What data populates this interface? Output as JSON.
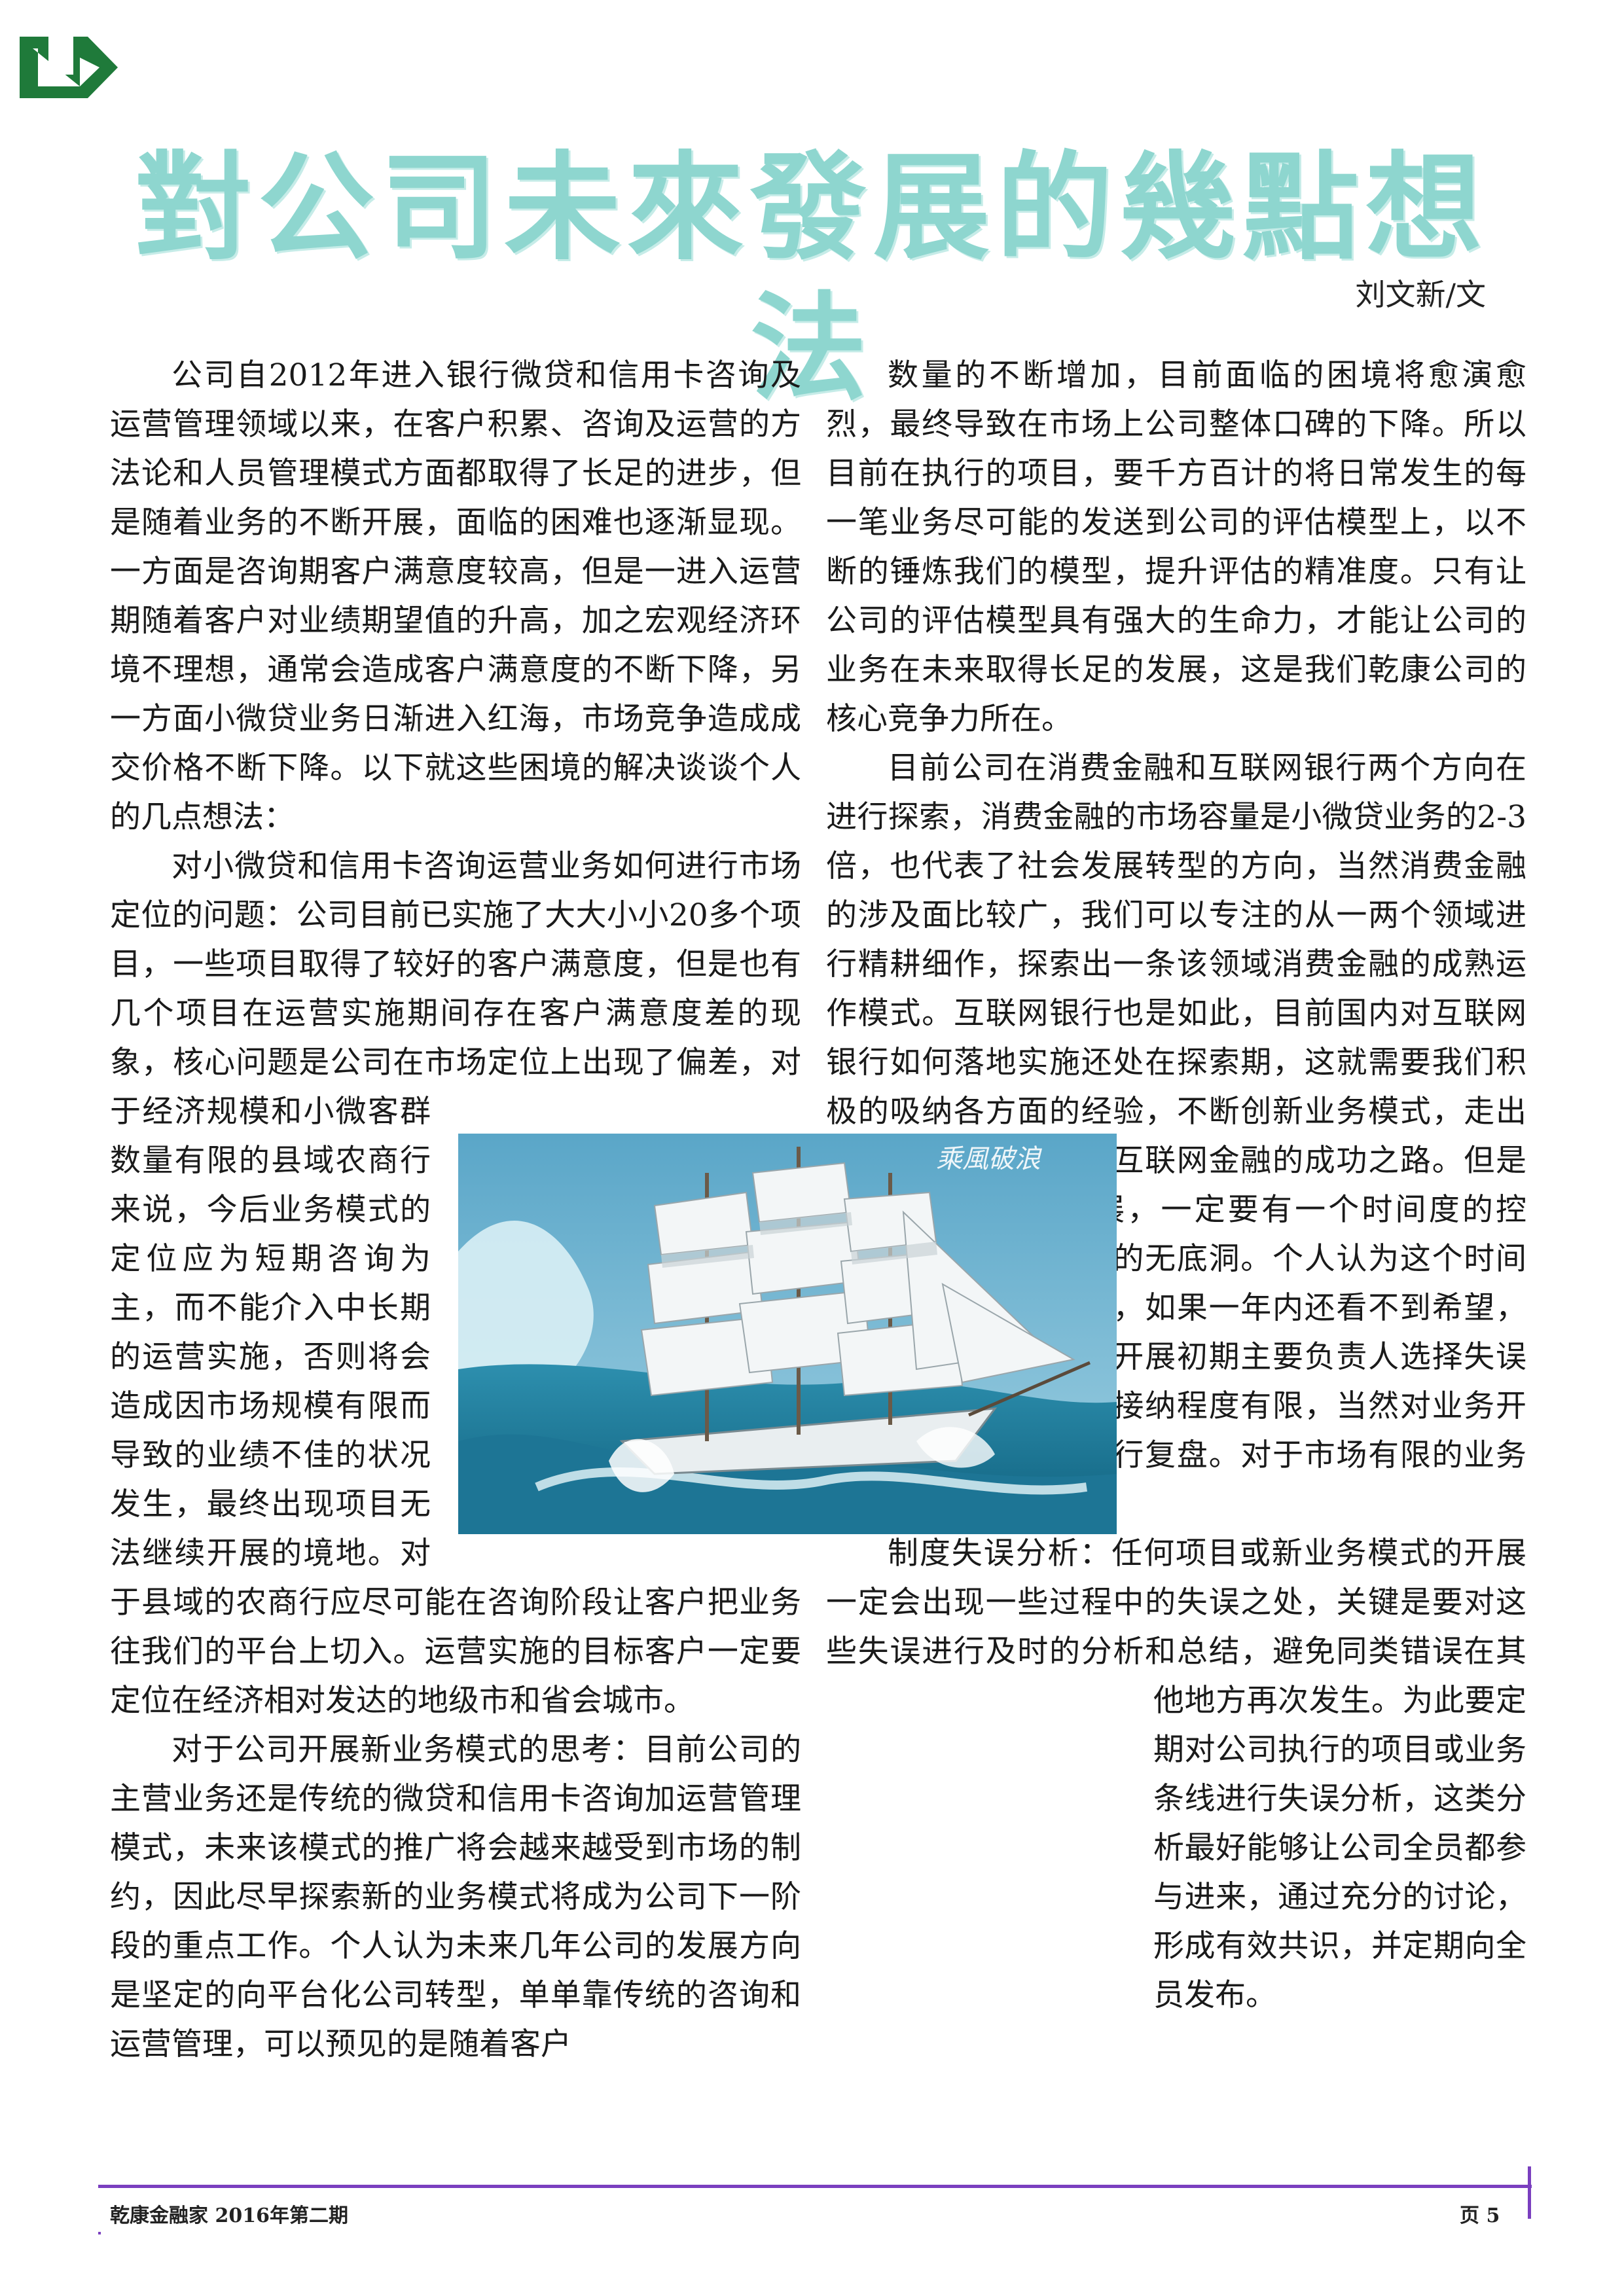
{
  "title": "對公司未來發展的幾點想法",
  "author": "刘文新/文",
  "image": {
    "caption": "乘風破浪"
  },
  "left_column": {
    "p1": "公司自2012年进入银行微贷和信用卡咨询及运营管理领域以来，在客户积累、咨询及运营的方法论和人员管理模式方面都取得了长足的进步，但是随着业务的不断开展，面临的困难也逐渐显现。一方面是咨询期客户满意度较高，但是一进入运营期随着客户对业绩期望值的升高，加之宏观经济环境不理想，通常会造成客户满意度的不断下降，另一方面小微贷业务日渐进入红海，市场竞争造成成交价格不断下降。以下就这些困境的解决谈谈个人的几点想法：",
    "p2": "对小微贷和信用卡咨询运营业务如何进行市场定位的问题：公司目前已实施了大大小小20多个项目，一些项目取得了较好的客户满意度，但是也有几个项目在运营实施期间存在客户满意度差的现象，核心问题是公司在市场定位上出现了偏差，对于经济规模和小微客群数量有限的县域农商行来说，今后业务模式的定位应为短期咨询为主，而不能介入中长期的运营实施，否则将会造成因市场规模有限而导致的业绩不佳的状况发生，最终出现项目无法继续开展的境地。对于县域的农商行应尽可能在咨询阶段让客户把业务往我们的平台上切入。运营实施的目标客户一定要定位在经济相对发达的地级市和省会城市。",
    "p3": "对于公司开展新业务模式的思考：目前公司的主营业务还是传统的微贷和信用卡咨询加运营管理模式，未来该模式的推广将会越来越受到市场的制约，因此尽早探索新的业务模式将成为公司下一阶段的重点工作。个人认为未来几年公司的发展方向是坚定的向平台化公司转型，单单靠传统的咨询和运营管理，可以预见的是随着客户"
  },
  "right_column": {
    "p1": "数量的不断增加，目前面临的困境将愈演愈烈，最终导致在市场上公司整体口碑的下降。所以目前在执行的项目，要千方百计的将日常发生的每一笔业务尽可能的发送到公司的评估模型上，以不断的锤炼我们的模型，提升评估的精准度。只有让公司的评估模型具有强大的生命力，才能让公司的业务在未来取得长足的发展，这是我们乾康公司的核心竞争力所在。",
    "p2": "目前公司在消费金融和互联网银行两个方向在进行探索，消费金融的市场容量是小微贷业务的2-3倍，也代表了社会发展转型的方向，当然消费金融的涉及面比较广，我们可以专注的从一两个领域进行精耕细作，探索出一条该领域消费金融的成熟运作模式。互联网银行也是如此，目前国内对互联网银行如何落地实施还处在探索期，这就需要我们积极的吸纳各方面的经验，不断创新业务模式，走出一条具有地方性银行互联网金融的成功之路。但是对新业务模式的开展，一定要有一个时间度的控制，以防止出现投入的无底洞。个人认为这个时间度最长不能超过一年，如果一年内还看不到希望，要进行总结，是业务开展初期主要负责人选择失误还是该业务模式市场接纳程度有限，当然对业务开展的整个过程也要进行复盘。对于市场有限的业务要坚决予以停止。",
    "p3": "制度失误分析：任何项目或新业务模式的开展一定会出现一些过程中的失误之处，关键是要对这些失误进行及时的分析和总结，避免同类错误在其他地方再次发生。为此要定期对公司执行的项目或业务条线进行失误分析，这类分析最好能够让公司全员都参与进来，通过充分的讨论，形成有效共识，并定期向全员发布。"
  },
  "footer": {
    "publication": "乾康金融家  2016年第二期",
    "page": "页 5"
  },
  "colors": {
    "title": "#8ed6cf",
    "logo": "#1f7a3a",
    "footer_rule": "#7a3fbf"
  }
}
